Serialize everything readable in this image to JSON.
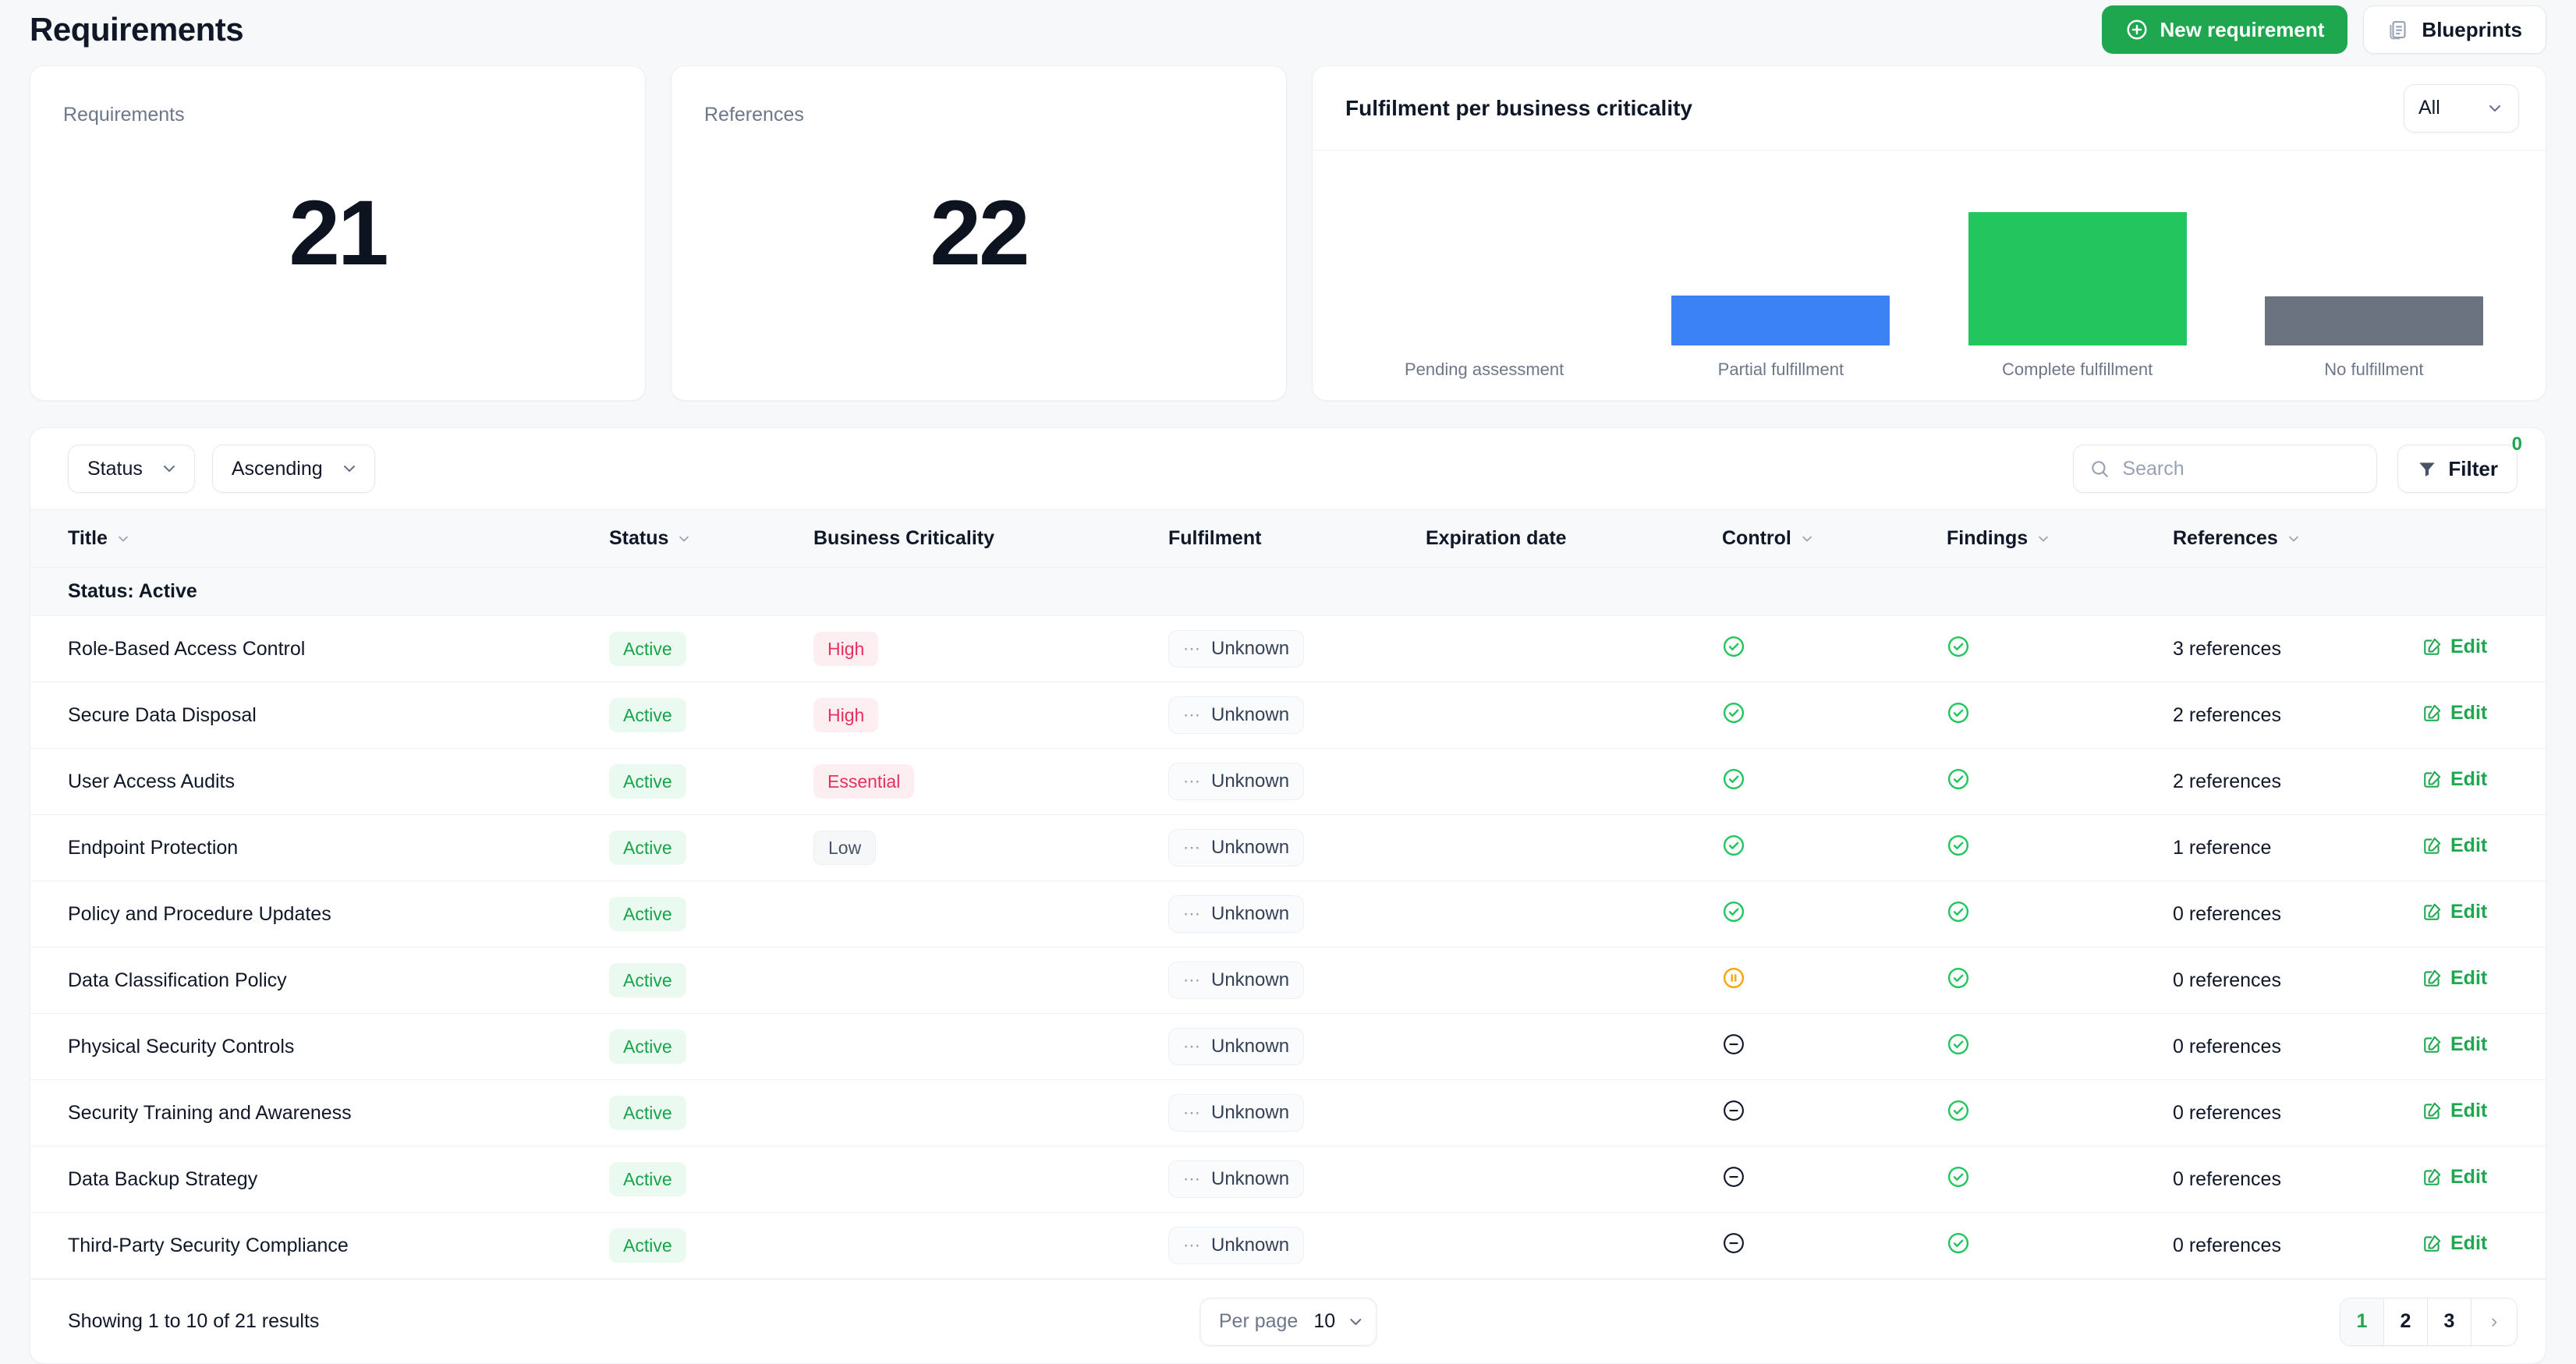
{
  "header": {
    "title": "Requirements",
    "new_requirement_label": "New requirement",
    "blueprints_label": "Blueprints"
  },
  "stats": [
    {
      "label": "Requirements",
      "value": "21"
    },
    {
      "label": "References",
      "value": "22"
    }
  ],
  "chart_card": {
    "title": "Fulfilment per business criticality",
    "filter_value": "All"
  },
  "chart_data": {
    "type": "bar",
    "title": "Fulfilment per business criticality",
    "xlabel": "",
    "ylabel": "",
    "grid": false,
    "legend": "none",
    "ylim": [
      0,
      13
    ],
    "categories": [
      "Pending assessment",
      "Partial fulfillment",
      "Complete fulfillment",
      "No fulfillment"
    ],
    "values": [
      0,
      4,
      11,
      4
    ],
    "colors": [
      "#cfd4dc",
      "#3b82f6",
      "#22c55e",
      "#6b7280"
    ],
    "bar_pixel_heights": [
      0,
      64,
      171,
      63
    ]
  },
  "toolbar": {
    "group_by_label": "Status",
    "sort_label": "Ascending",
    "search_placeholder": "Search",
    "search_value": "",
    "filter_label": "Filter",
    "filter_count": "0"
  },
  "table": {
    "columns": [
      {
        "label": "Title",
        "sortable": true
      },
      {
        "label": "Status",
        "sortable": true
      },
      {
        "label": "Business Criticality",
        "sortable": false
      },
      {
        "label": "Fulfilment",
        "sortable": false
      },
      {
        "label": "Expiration date",
        "sortable": false
      },
      {
        "label": "Control",
        "sortable": true
      },
      {
        "label": "Findings",
        "sortable": true
      },
      {
        "label": "References",
        "sortable": true
      }
    ],
    "group_label": "Status: Active",
    "edit_label": "Edit",
    "rows": [
      {
        "title": "Role-Based Access Control",
        "status": "Active",
        "criticality": "High",
        "criticality_kind": "high",
        "fulfilment": "Unknown",
        "expiration": "",
        "control": "check",
        "findings": "check",
        "references": "3 references"
      },
      {
        "title": "Secure Data Disposal",
        "status": "Active",
        "criticality": "High",
        "criticality_kind": "high",
        "fulfilment": "Unknown",
        "expiration": "",
        "control": "check",
        "findings": "check",
        "references": "2 references"
      },
      {
        "title": "User Access Audits",
        "status": "Active",
        "criticality": "Essential",
        "criticality_kind": "essential",
        "fulfilment": "Unknown",
        "expiration": "",
        "control": "check",
        "findings": "check",
        "references": "2 references"
      },
      {
        "title": "Endpoint Protection",
        "status": "Active",
        "criticality": "Low",
        "criticality_kind": "low",
        "fulfilment": "Unknown",
        "expiration": "",
        "control": "check",
        "findings": "check",
        "references": "1 reference"
      },
      {
        "title": "Policy and Procedure Updates",
        "status": "Active",
        "criticality": "",
        "criticality_kind": "none",
        "fulfilment": "Unknown",
        "expiration": "",
        "control": "check",
        "findings": "check",
        "references": "0 references"
      },
      {
        "title": "Data Classification Policy",
        "status": "Active",
        "criticality": "",
        "criticality_kind": "none",
        "fulfilment": "Unknown",
        "expiration": "",
        "control": "pause",
        "findings": "check",
        "references": "0 references"
      },
      {
        "title": "Physical Security Controls",
        "status": "Active",
        "criticality": "",
        "criticality_kind": "none",
        "fulfilment": "Unknown",
        "expiration": "",
        "control": "minus",
        "findings": "check",
        "references": "0 references"
      },
      {
        "title": "Security Training and Awareness",
        "status": "Active",
        "criticality": "",
        "criticality_kind": "none",
        "fulfilment": "Unknown",
        "expiration": "",
        "control": "minus",
        "findings": "check",
        "references": "0 references"
      },
      {
        "title": "Data Backup Strategy",
        "status": "Active",
        "criticality": "",
        "criticality_kind": "none",
        "fulfilment": "Unknown",
        "expiration": "",
        "control": "minus",
        "findings": "check",
        "references": "0 references"
      },
      {
        "title": "Third-Party Security Compliance",
        "status": "Active",
        "criticality": "",
        "criticality_kind": "none",
        "fulfilment": "Unknown",
        "expiration": "",
        "control": "minus",
        "findings": "check",
        "references": "0 references"
      }
    ]
  },
  "footer": {
    "showing": "Showing 1 to 10 of 21 results",
    "per_page_label": "Per page",
    "per_page_value": "10",
    "pages": [
      "1",
      "2",
      "3"
    ],
    "active_page": "1",
    "next_label": "›"
  },
  "colors": {
    "brand_green": "#1fa750",
    "status_green": "#17a34a",
    "criticality_red": "#e8305d",
    "bar_blue": "#3b82f6",
    "bar_green": "#22c55e",
    "bar_gray": "#6b7280",
    "pause_amber": "#f5a700"
  }
}
